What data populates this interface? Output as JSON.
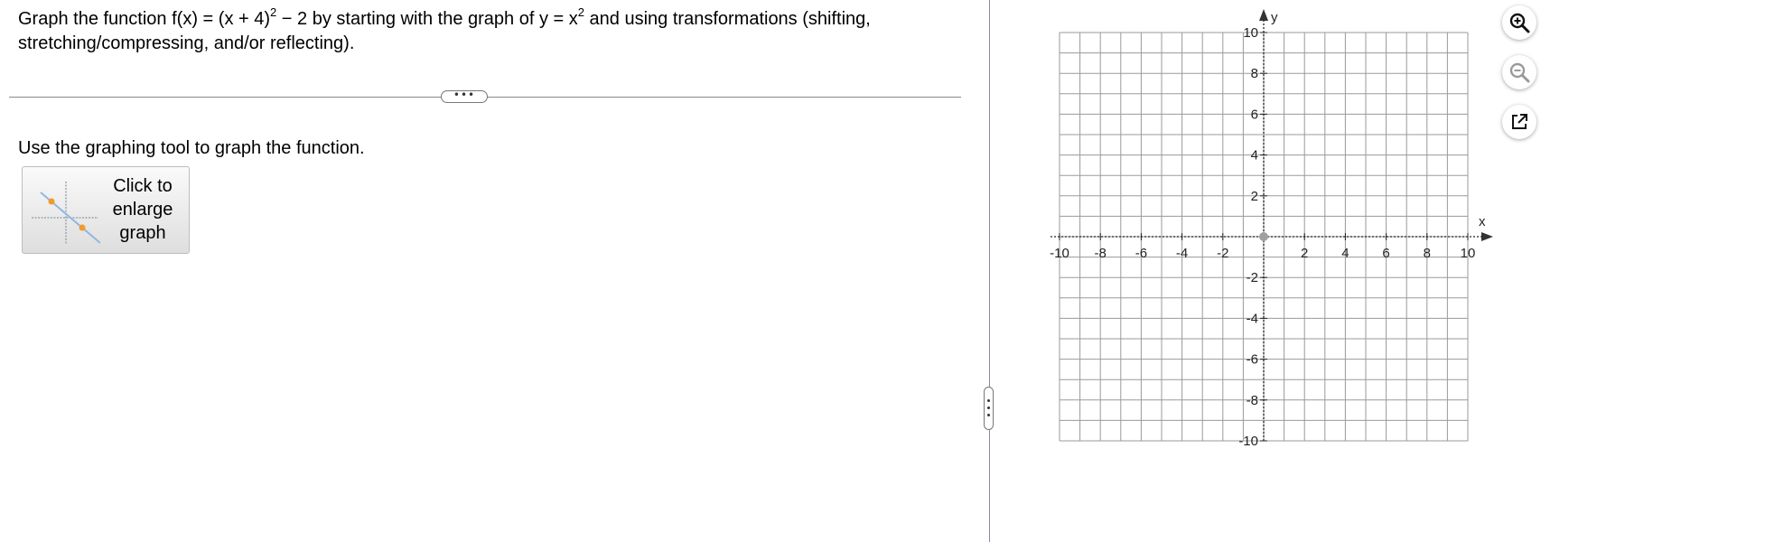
{
  "question": {
    "intro": "Graph the function f(x) = (x + 4)",
    "exp1": "2",
    "mid": " − 2 by starting with the graph of y = x",
    "exp2": "2",
    "outro": " and using transformations (shifting, stretching/compressing, and/or reflecting)."
  },
  "divider_handle_label": "•••",
  "instruction": "Use the graphing tool to graph the function.",
  "enlarge_button": {
    "line1": "Click to",
    "line2": "enlarge",
    "line3": "graph"
  },
  "graph": {
    "x_label": "x",
    "y_label": "y",
    "x_range": [
      -10,
      10
    ],
    "y_range": [
      -10,
      10
    ],
    "grid_step": 1,
    "tick_label_step": 2,
    "x_tick_labels": [
      "-10",
      "-8",
      "-6",
      "-4",
      "-2",
      "2",
      "4",
      "6",
      "8",
      "10"
    ],
    "y_tick_labels": [
      "10",
      "8",
      "6",
      "4",
      "2",
      "-2",
      "-4",
      "-6",
      "-8",
      "-10"
    ],
    "origin_point_color": "#a0a0a0",
    "grid_color": "#9a9a9a"
  },
  "tools": [
    {
      "name": "zoom-in-icon",
      "enabled": true
    },
    {
      "name": "zoom-out-icon",
      "enabled": false
    },
    {
      "name": "pop-out-icon",
      "enabled": true
    }
  ]
}
